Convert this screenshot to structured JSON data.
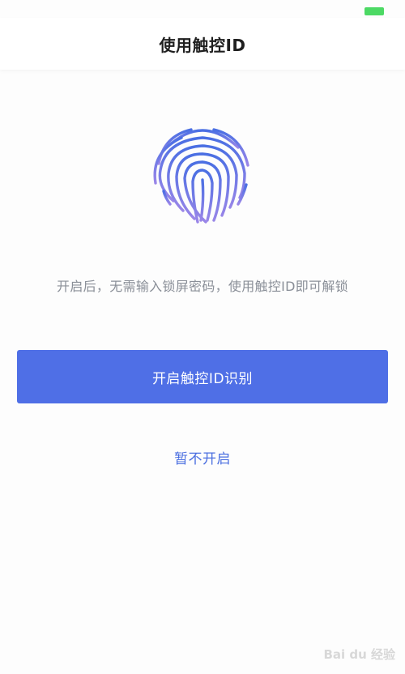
{
  "status_bar": {
    "battery_icon": "battery-icon",
    "battery_color": "#4cd964"
  },
  "header": {
    "title": "使用触控ID"
  },
  "main": {
    "fingerprint_icon": "fingerprint-icon",
    "description": "开启后，无需输入锁屏密码，使用触控ID即可解锁",
    "enable_button_label": "开启触控ID识别",
    "skip_link_label": "暂不开启"
  },
  "watermark": {
    "text": "Bai du 经验"
  },
  "colors": {
    "accent": "#4f6fe6",
    "link": "#4a6ee0",
    "fingerprint_gradient_start": "#4a6fe3",
    "fingerprint_gradient_end": "#9a86e8"
  }
}
